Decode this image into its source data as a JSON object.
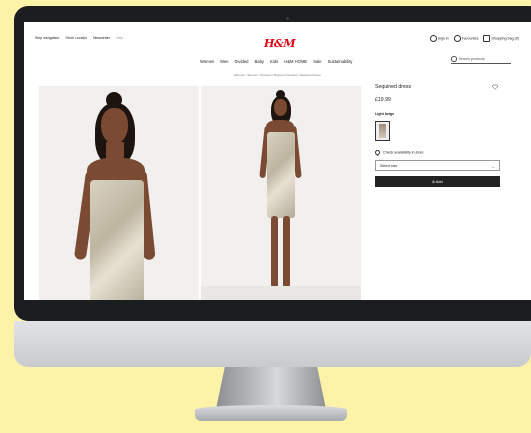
{
  "header": {
    "utility_left": [
      "Skip navigation",
      "Store Locator",
      "Newsletter"
    ],
    "utility_left_muted": "Help",
    "logo": "H&M",
    "utility_right": [
      "Sign in",
      "Favourites",
      "Shopping bag (0)"
    ]
  },
  "nav": {
    "items": [
      "Women",
      "Men",
      "Divided",
      "Baby",
      "Kids",
      "H&M HOME",
      "Sale",
      "Sustainability"
    ]
  },
  "search": {
    "placeholder": "Search products"
  },
  "breadcrumb": "HM.com / Women / Dresses / Bodycon Dresses / Sequined dress",
  "product": {
    "title": "Sequined dress",
    "price": "£19.99",
    "color_label": "Light beige",
    "store_availability": "Check availability in store",
    "size_placeholder": "Select size",
    "add_button": "Add"
  },
  "colors": {
    "logo_red": "#e50010",
    "button_dark": "#222222",
    "background_yellow": "#fdf3a8"
  }
}
